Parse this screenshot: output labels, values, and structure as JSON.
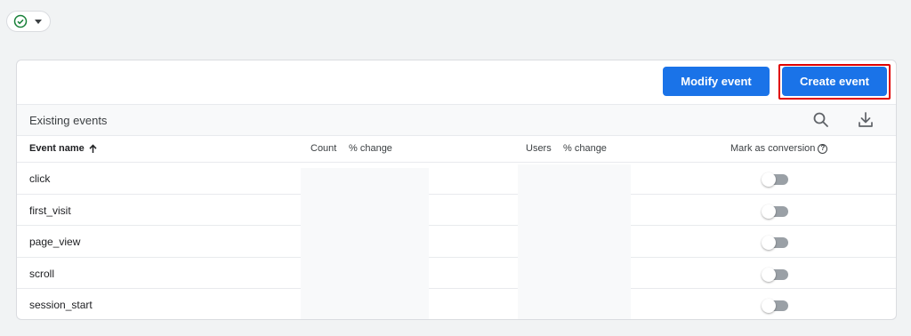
{
  "status_chip": {
    "icon": "check-circle-icon",
    "caret_icon": "caret-down-icon"
  },
  "toolbar": {
    "modify_label": "Modify event",
    "create_label": "Create event"
  },
  "events": {
    "title": "Existing events",
    "search_icon": "search-icon",
    "download_icon": "download-icon",
    "columns": {
      "event_name": "Event name",
      "count": "Count",
      "count_change": "% change",
      "users": "Users",
      "users_change": "% change",
      "mark_as_conversion": "Mark as conversion",
      "help_glyph": "?"
    },
    "rows": [
      {
        "name": "click",
        "conversion": false
      },
      {
        "name": "first_visit",
        "conversion": false
      },
      {
        "name": "page_view",
        "conversion": false
      },
      {
        "name": "scroll",
        "conversion": false
      },
      {
        "name": "session_start",
        "conversion": false
      }
    ]
  },
  "colors": {
    "primary": "#1a73e8",
    "highlight": "#e00000",
    "check": "#188038"
  }
}
